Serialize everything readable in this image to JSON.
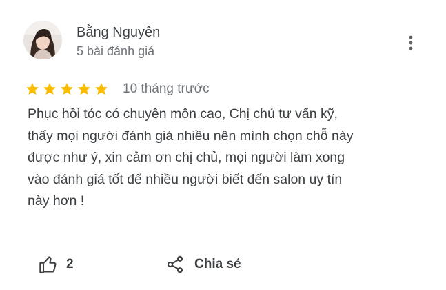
{
  "review": {
    "author_name": "Bằng Nguyên",
    "author_meta": "5 bài đánh giá",
    "rating": 5,
    "rating_max": 5,
    "time_ago": "10 tháng trước",
    "text_lines": [
      "Phục hồi tóc có chuyên môn cao, Chị chủ tư vấn kỹ,",
      "thấy mọi người đánh giá nhiều nên mình chọn chỗ này",
      "được như ý, xin cảm ơn chị chủ, mọi người làm xong",
      "vào đánh giá tốt để nhiều người biết đến salon uy tín",
      "này hơn !"
    ]
  },
  "actions": {
    "like_count": "2",
    "share_label": "Chia sẻ"
  },
  "colors": {
    "star": "#fbbc04",
    "text": "#3c4043",
    "muted": "#70757a"
  },
  "icons": {
    "more": "more-vert-icon",
    "like": "thumb-up-icon",
    "share": "share-icon",
    "star": "star-icon"
  }
}
